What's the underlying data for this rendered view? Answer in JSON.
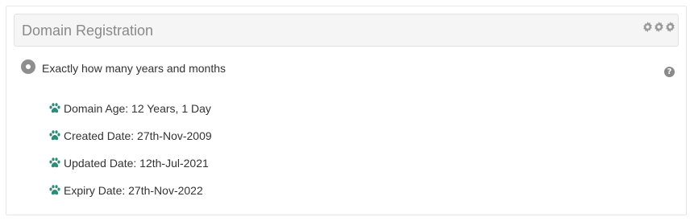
{
  "panel": {
    "title": "Domain Registration",
    "header_icons": [
      "gear-icon",
      "gear-icon",
      "gear-icon"
    ]
  },
  "question": {
    "text": "Exactly how many years and months",
    "help_icon": "question-circle-icon"
  },
  "details": [
    {
      "icon": "paw-icon",
      "label": "Domain Age: 12 Years, 1 Day"
    },
    {
      "icon": "paw-icon",
      "label": "Created Date: 27th-Nov-2009"
    },
    {
      "icon": "paw-icon",
      "label": "Updated Date: 12th-Jul-2021"
    },
    {
      "icon": "paw-icon",
      "label": "Expiry Date: 27th-Nov-2022"
    }
  ],
  "colors": {
    "paw": "#2e8b7a",
    "header_bg": "#f5f5f5",
    "muted": "#8a8a8a"
  }
}
